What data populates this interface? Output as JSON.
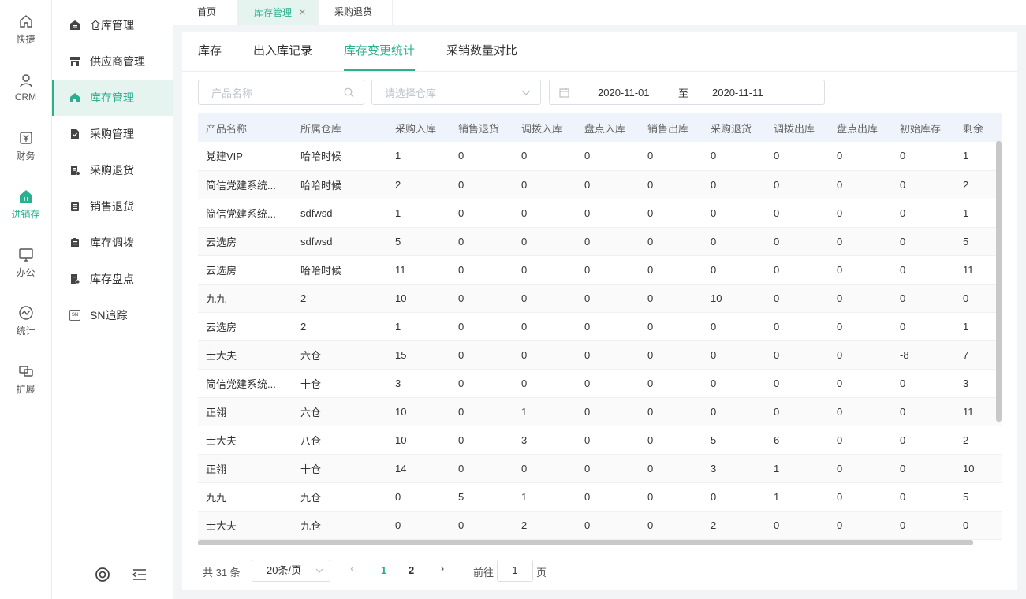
{
  "rail": [
    {
      "label": "快捷",
      "icon": "home-icon"
    },
    {
      "label": "CRM",
      "icon": "user-icon"
    },
    {
      "label": "财务",
      "icon": "yen-icon"
    },
    {
      "label": "进销存",
      "icon": "store-icon",
      "active": true
    },
    {
      "label": "办公",
      "icon": "monitor-icon"
    },
    {
      "label": "统计",
      "icon": "chart-icon"
    },
    {
      "label": "扩展",
      "icon": "extend-icon"
    }
  ],
  "sidebar": [
    {
      "label": "仓库管理"
    },
    {
      "label": "供应商管理"
    },
    {
      "label": "库存管理",
      "active": true
    },
    {
      "label": "采购管理"
    },
    {
      "label": "采购退货"
    },
    {
      "label": "销售退货"
    },
    {
      "label": "库存调拨"
    },
    {
      "label": "库存盘点"
    },
    {
      "label": "SN追踪",
      "icon_text": "SN"
    }
  ],
  "top_tabs": [
    {
      "label": "首页"
    },
    {
      "label": "库存管理",
      "close": "×",
      "active": true
    },
    {
      "label": "采购退货"
    }
  ],
  "sub_tabs": [
    {
      "label": "库存"
    },
    {
      "label": "出入库记录"
    },
    {
      "label": "库存变更统计",
      "active": true
    },
    {
      "label": "采销数量对比"
    }
  ],
  "filters": {
    "product_placeholder": "产品名称",
    "warehouse_placeholder": "请选择仓库",
    "date_start": "2020-11-01",
    "date_sep": "至",
    "date_end": "2020-11-11"
  },
  "table": {
    "headers": [
      "产品名称",
      "所属仓库",
      "采购入库",
      "销售退货",
      "调拨入库",
      "盘点入库",
      "销售出库",
      "采购退货",
      "调拨出库",
      "盘点出库",
      "初始库存",
      "剩余"
    ],
    "rows": [
      [
        "党建VIP",
        "哈哈时候",
        "1",
        "0",
        "0",
        "0",
        "0",
        "0",
        "0",
        "0",
        "0",
        "1"
      ],
      [
        "简信党建系统...",
        "哈哈时候",
        "2",
        "0",
        "0",
        "0",
        "0",
        "0",
        "0",
        "0",
        "0",
        "2"
      ],
      [
        "简信党建系统...",
        "sdfwsd",
        "1",
        "0",
        "0",
        "0",
        "0",
        "0",
        "0",
        "0",
        "0",
        "1"
      ],
      [
        "云选房",
        "sdfwsd",
        "5",
        "0",
        "0",
        "0",
        "0",
        "0",
        "0",
        "0",
        "0",
        "5"
      ],
      [
        "云选房",
        "哈哈时候",
        "11",
        "0",
        "0",
        "0",
        "0",
        "0",
        "0",
        "0",
        "0",
        "11"
      ],
      [
        "九九",
        "2",
        "10",
        "0",
        "0",
        "0",
        "0",
        "10",
        "0",
        "0",
        "0",
        "0"
      ],
      [
        "云选房",
        "2",
        "1",
        "0",
        "0",
        "0",
        "0",
        "0",
        "0",
        "0",
        "0",
        "1"
      ],
      [
        "士大夫",
        "六仓",
        "15",
        "0",
        "0",
        "0",
        "0",
        "0",
        "0",
        "0",
        "-8",
        "7"
      ],
      [
        "简信党建系统...",
        "十仓",
        "3",
        "0",
        "0",
        "0",
        "0",
        "0",
        "0",
        "0",
        "0",
        "3"
      ],
      [
        "正翎",
        "六仓",
        "10",
        "0",
        "1",
        "0",
        "0",
        "0",
        "0",
        "0",
        "0",
        "11"
      ],
      [
        "士大夫",
        "八仓",
        "10",
        "0",
        "3",
        "0",
        "0",
        "5",
        "6",
        "0",
        "0",
        "2"
      ],
      [
        "正翎",
        "十仓",
        "14",
        "0",
        "0",
        "0",
        "0",
        "3",
        "1",
        "0",
        "0",
        "10"
      ],
      [
        "九九",
        "九仓",
        "0",
        "5",
        "1",
        "0",
        "0",
        "0",
        "1",
        "0",
        "0",
        "5"
      ],
      [
        "士大夫",
        "九仓",
        "0",
        "0",
        "2",
        "0",
        "0",
        "2",
        "0",
        "0",
        "0",
        "0"
      ]
    ]
  },
  "pagination": {
    "total": "共 31 条",
    "page_size": "20条/页",
    "pages": [
      "1",
      "2"
    ],
    "current": "1",
    "goto_label": "前往",
    "goto_value": "1",
    "page_unit": "页",
    "prev": "‹",
    "next": "›"
  },
  "colors": {
    "accent": "#2ab08f",
    "header_bg": "#eef3fc",
    "active_bg": "#e5f4ef"
  }
}
